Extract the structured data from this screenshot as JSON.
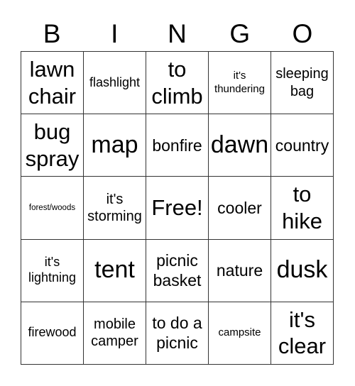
{
  "header": {
    "letters": [
      "B",
      "I",
      "N",
      "G",
      "O"
    ]
  },
  "board": {
    "rows": [
      [
        {
          "text": "lawn chair",
          "size": "s-l"
        },
        {
          "text": "flashlight",
          "size": "s-s"
        },
        {
          "text": "to climb",
          "size": "s-l"
        },
        {
          "text": "it's thundering",
          "size": "s-xs"
        },
        {
          "text": "sleeping bag",
          "size": "s-ms"
        }
      ],
      [
        {
          "text": "bug spray",
          "size": "s-l"
        },
        {
          "text": "map",
          "size": "s-xl"
        },
        {
          "text": "bonfire",
          "size": "s-m"
        },
        {
          "text": "dawn",
          "size": "s-xl"
        },
        {
          "text": "country",
          "size": "s-m"
        }
      ],
      [
        {
          "text": "forest/woods",
          "size": "s-xxs"
        },
        {
          "text": "it's storming",
          "size": "s-ms"
        },
        {
          "text": "Free!",
          "size": "s-l"
        },
        {
          "text": "cooler",
          "size": "s-m"
        },
        {
          "text": "to hike",
          "size": "s-l"
        }
      ],
      [
        {
          "text": "it's lightning",
          "size": "s-s"
        },
        {
          "text": "tent",
          "size": "s-xl"
        },
        {
          "text": "picnic basket",
          "size": "s-m"
        },
        {
          "text": "nature",
          "size": "s-m"
        },
        {
          "text": "dusk",
          "size": "s-xl"
        }
      ],
      [
        {
          "text": "firewood",
          "size": "s-s"
        },
        {
          "text": "mobile camper",
          "size": "s-ms"
        },
        {
          "text": "to do a picnic",
          "size": "s-m"
        },
        {
          "text": "campsite",
          "size": "s-xs"
        },
        {
          "text": "it's clear",
          "size": "s-l"
        }
      ]
    ]
  }
}
